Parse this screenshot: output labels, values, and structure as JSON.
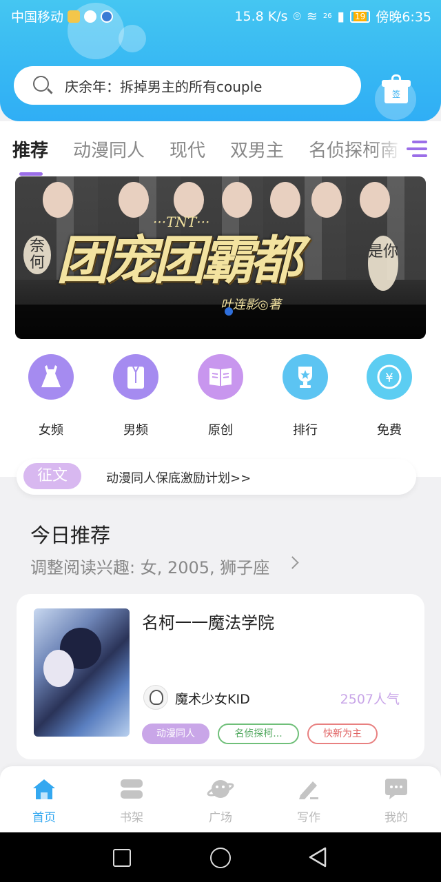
{
  "status_bar": {
    "carrier": "中国移动",
    "network_speed": "15.8 K/s",
    "signal_label": "26",
    "battery": "19",
    "time": "傍晚6:35"
  },
  "search": {
    "placeholder": "庆余年：拆掉男主的所有couple",
    "gift_label": "签"
  },
  "tabs": [
    {
      "label": "推荐",
      "active": true
    },
    {
      "label": "动漫同人"
    },
    {
      "label": "现代"
    },
    {
      "label": "双男主"
    },
    {
      "label": "名侦探柯南"
    }
  ],
  "banner": {
    "tnt": "···TNT···",
    "title": "团宠团霸都",
    "side_left": "奈何",
    "side_right": "是你",
    "author": "叶连影◎著"
  },
  "categories": [
    {
      "label": "女频",
      "icon": "dress-icon",
      "color": "#a58bf0"
    },
    {
      "label": "男频",
      "icon": "shirt-icon",
      "color": "#a58bf0"
    },
    {
      "label": "原创",
      "icon": "book-icon",
      "color": "#c896ee"
    },
    {
      "label": "排行",
      "icon": "trophy-icon",
      "color": "#5cc4f2"
    },
    {
      "label": "免费",
      "icon": "coin-icon",
      "color": "#5ccdf2"
    }
  ],
  "notice": {
    "tag": "征文",
    "text": "动漫同人保底激励计划>>"
  },
  "today": {
    "title": "今日推荐",
    "interest": "调整阅读兴趣: 女, 2005, 狮子座"
  },
  "book": {
    "title": "名柯一一魔法学院",
    "author": "魔术少女KID",
    "popularity": "2507人气",
    "tags": [
      "动漫同人",
      "名侦探柯...",
      "快新为主"
    ]
  },
  "bottom_nav": [
    {
      "label": "首页",
      "icon": "home-icon",
      "active": true
    },
    {
      "label": "书架",
      "icon": "bookshelf-icon"
    },
    {
      "label": "广场",
      "icon": "planet-icon"
    },
    {
      "label": "写作",
      "icon": "pen-icon"
    },
    {
      "label": "我的",
      "icon": "chat-bubble-icon"
    }
  ],
  "colors": {
    "header": "#36b7f3",
    "accent_purple": "#9b6ee8",
    "nav_active": "#34a8f0"
  }
}
